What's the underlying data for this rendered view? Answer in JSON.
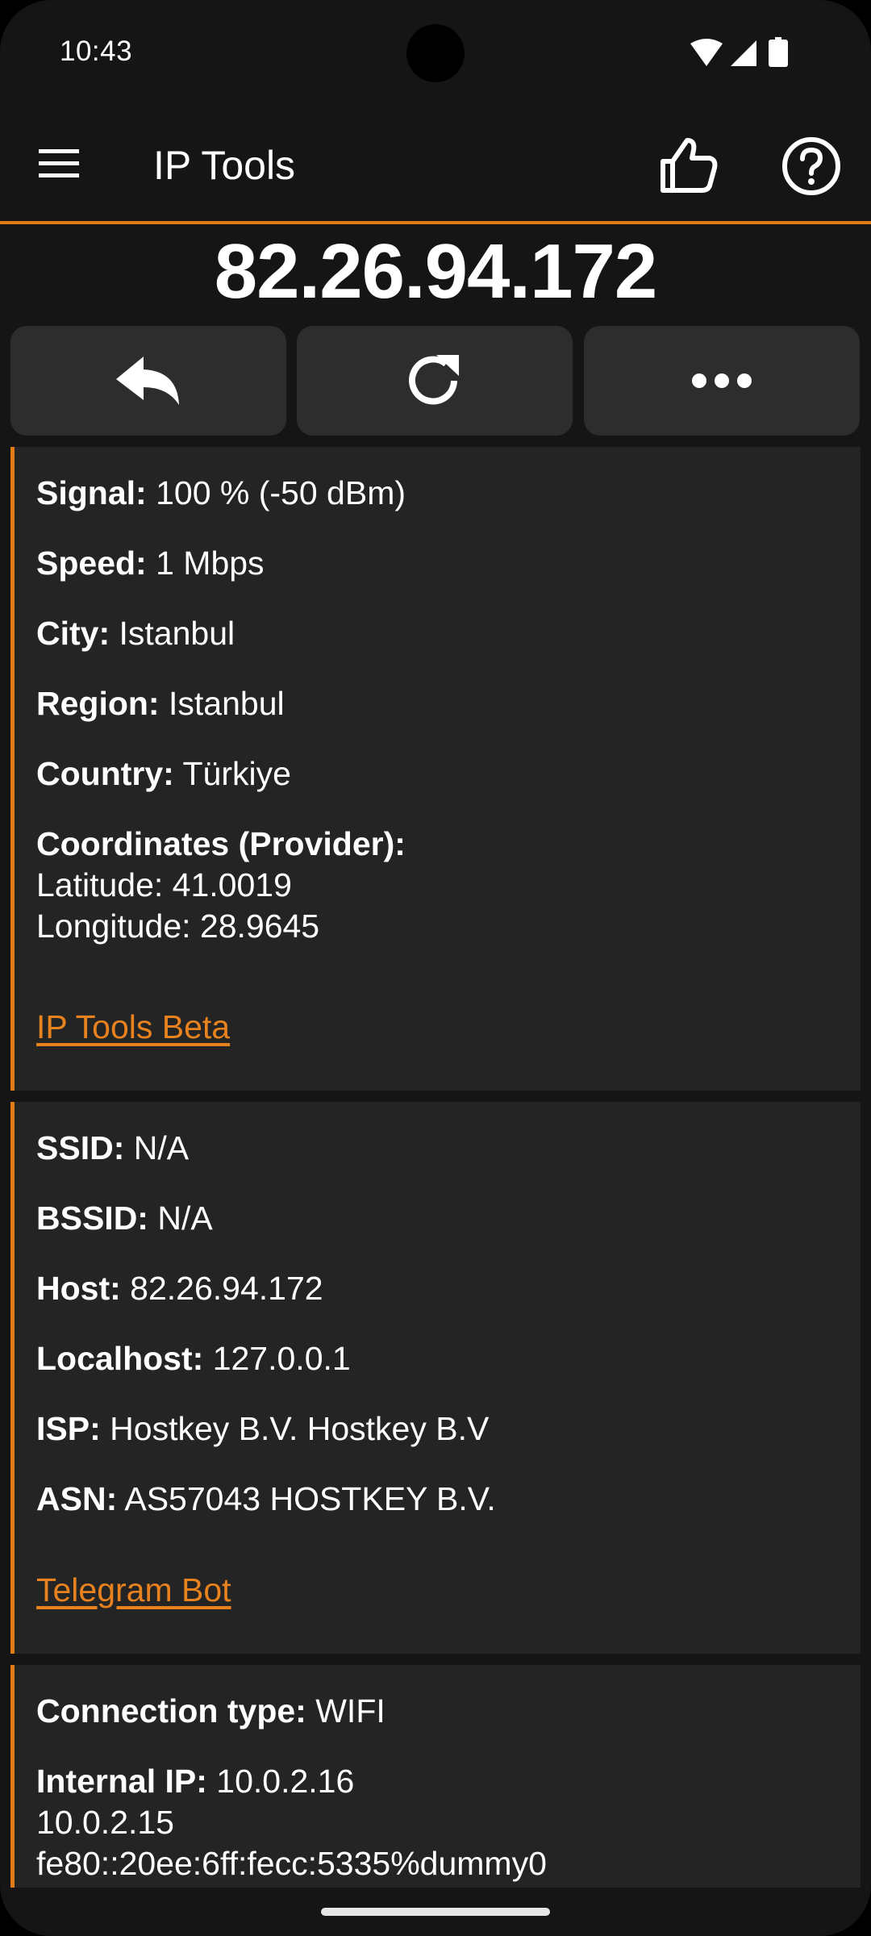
{
  "status_bar": {
    "time": "10:43",
    "icons": [
      "wifi-icon",
      "signal-icon",
      "battery-icon"
    ]
  },
  "app_bar": {
    "title": "IP Tools",
    "icons": [
      "menu-icon",
      "thumbs-up-icon",
      "help-icon"
    ]
  },
  "ip_address": "82.26.94.172",
  "actions": [
    {
      "icon": "share-icon"
    },
    {
      "icon": "refresh-icon"
    },
    {
      "icon": "more-icon"
    }
  ],
  "cards": [
    {
      "rows": [
        {
          "label": "Signal:",
          "value": "100 % (-50 dBm)"
        },
        {
          "label": "Speed:",
          "value": "1 Mbps"
        },
        {
          "label": "City:",
          "value": "Istanbul"
        },
        {
          "label": "Region:",
          "value": "Istanbul"
        },
        {
          "label": "Country:",
          "value": "Türkiye"
        },
        {
          "label": "Coordinates (Provider):",
          "value": ""
        }
      ],
      "coords": {
        "latitude": "Latitude: 41.0019",
        "longitude": "Longitude: 28.9645"
      },
      "link": "IP Tools Beta"
    },
    {
      "rows": [
        {
          "label": "SSID:",
          "value": "N/A"
        },
        {
          "label": "BSSID:",
          "value": "N/A"
        },
        {
          "label": "Host:",
          "value": "82.26.94.172"
        },
        {
          "label": "Localhost:",
          "value": "127.0.0.1"
        },
        {
          "label": "ISP:",
          "value": "Hostkey B.V. Hostkey B.V"
        },
        {
          "label": "ASN:",
          "value": "AS57043 HOSTKEY B.V."
        }
      ],
      "link": "Telegram Bot"
    },
    {
      "rows": [
        {
          "label": "Connection type:",
          "value": "WIFI"
        },
        {
          "label": "Internal IP:",
          "value": "10.0.2.16"
        }
      ],
      "extra_lines": [
        "10.0.2.15",
        "fe80::20ee:6ff:fecc:5335%dummy0"
      ]
    }
  ],
  "colors": {
    "accent": "#e17b16",
    "background": "#151515",
    "card": "#242424",
    "button": "#2d2d2d"
  }
}
